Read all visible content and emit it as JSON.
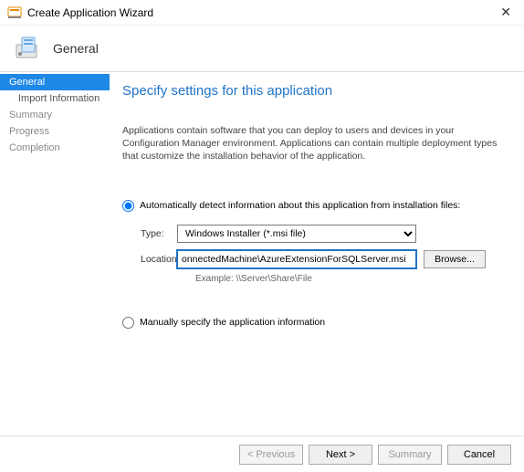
{
  "window": {
    "title": "Create Application Wizard",
    "close": "✕"
  },
  "header": {
    "title": "General"
  },
  "sidebar": {
    "items": [
      {
        "label": "General",
        "active": true
      },
      {
        "label": "Import Information",
        "sub": true
      },
      {
        "label": "Summary"
      },
      {
        "label": "Progress"
      },
      {
        "label": "Completion"
      }
    ]
  },
  "main": {
    "heading": "Specify settings for this application",
    "description": "Applications contain software that you can deploy to users and devices in your Configuration Manager environment. Applications can contain multiple deployment types that customize the installation behavior of the application.",
    "radio_auto": "Automatically detect information about this application from installation files:",
    "radio_manual": "Manually specify the application information",
    "type_label": "Type:",
    "type_value": "Windows Installer (*.msi file)",
    "location_label": "Location:",
    "location_value": "onnectedMachine\\AzureExtensionForSQLServer.msi",
    "browse": "Browse...",
    "example": "Example: \\\\Server\\Share\\File"
  },
  "footer": {
    "previous": "< Previous",
    "next": "Next >",
    "summary": "Summary",
    "cancel": "Cancel"
  }
}
